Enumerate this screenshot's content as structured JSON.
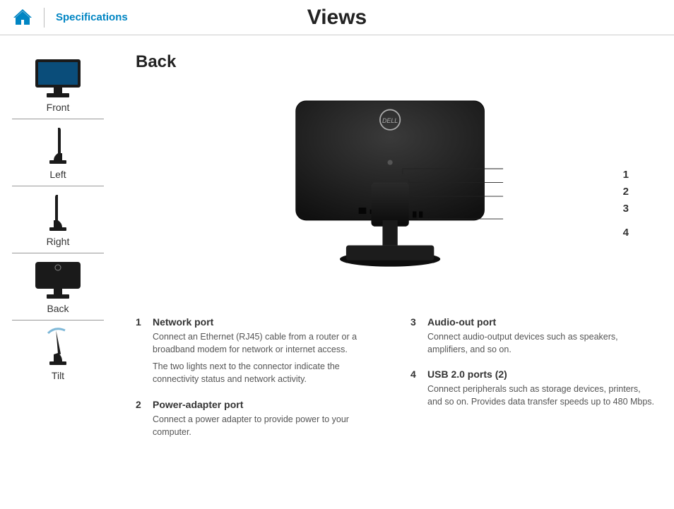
{
  "header": {
    "spec_label": "Specifications",
    "title": "Views"
  },
  "section_heading": "Back",
  "sidebar": {
    "items": [
      {
        "label": "Front"
      },
      {
        "label": "Left"
      },
      {
        "label": "Right"
      },
      {
        "label": "Back"
      },
      {
        "label": "Tilt"
      }
    ]
  },
  "callouts": [
    "1",
    "2",
    "3",
    "4"
  ],
  "descriptions": {
    "left": [
      {
        "num": "1",
        "title": "Network port",
        "paras": [
          "Connect an Ethernet (RJ45) cable from a router or a broadband modem for network or internet access.",
          "The two lights next to the connector indicate the connectivity status and network activity."
        ]
      },
      {
        "num": "2",
        "title": "Power-adapter port",
        "paras": [
          "Connect a power adapter to provide power to your computer."
        ]
      }
    ],
    "right": [
      {
        "num": "3",
        "title": "Audio-out port",
        "paras": [
          "Connect audio-output devices such as speakers, amplifiers, and so on."
        ]
      },
      {
        "num": "4",
        "title": "USB 2.0 ports (2)",
        "paras": [
          "Connect peripherals such as storage devices, printers, and so on. Provides data transfer speeds up to 480 Mbps."
        ]
      }
    ]
  }
}
